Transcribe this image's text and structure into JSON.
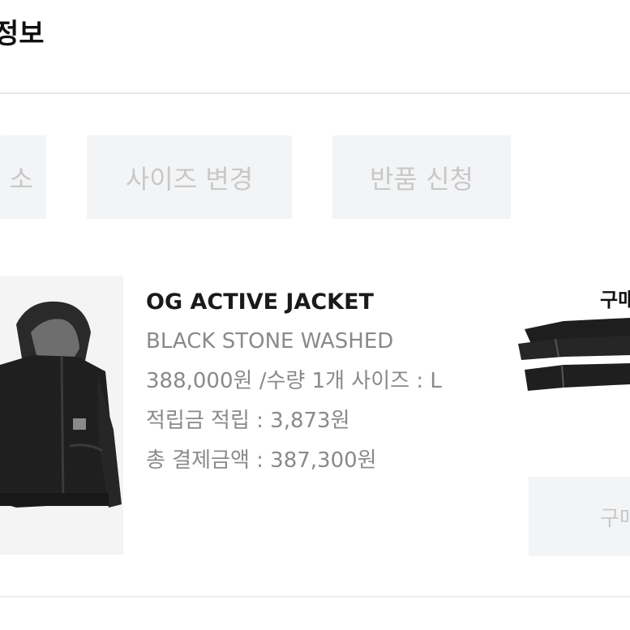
{
  "header": {
    "title": "정보"
  },
  "actions": {
    "cancel_label": "소",
    "size_change_label": "사이즈 변경",
    "return_label": "반품 신청"
  },
  "product": {
    "name": "OG ACTIVE JACKET",
    "color": "BLACK STONE WASHED",
    "price_line": "388,000원 /수량 1개 사이즈 : L",
    "points_line": "적립금 적립 : 3,873원",
    "total_line": "총 결제금액 : 387,300원"
  },
  "side": {
    "label": "구매",
    "confirm_label": "구매"
  },
  "colors": {
    "button_bg": "#f3f4f6",
    "button_text": "#c8c8c8",
    "title_text": "#111111",
    "meta_text": "#8a8a8a"
  }
}
